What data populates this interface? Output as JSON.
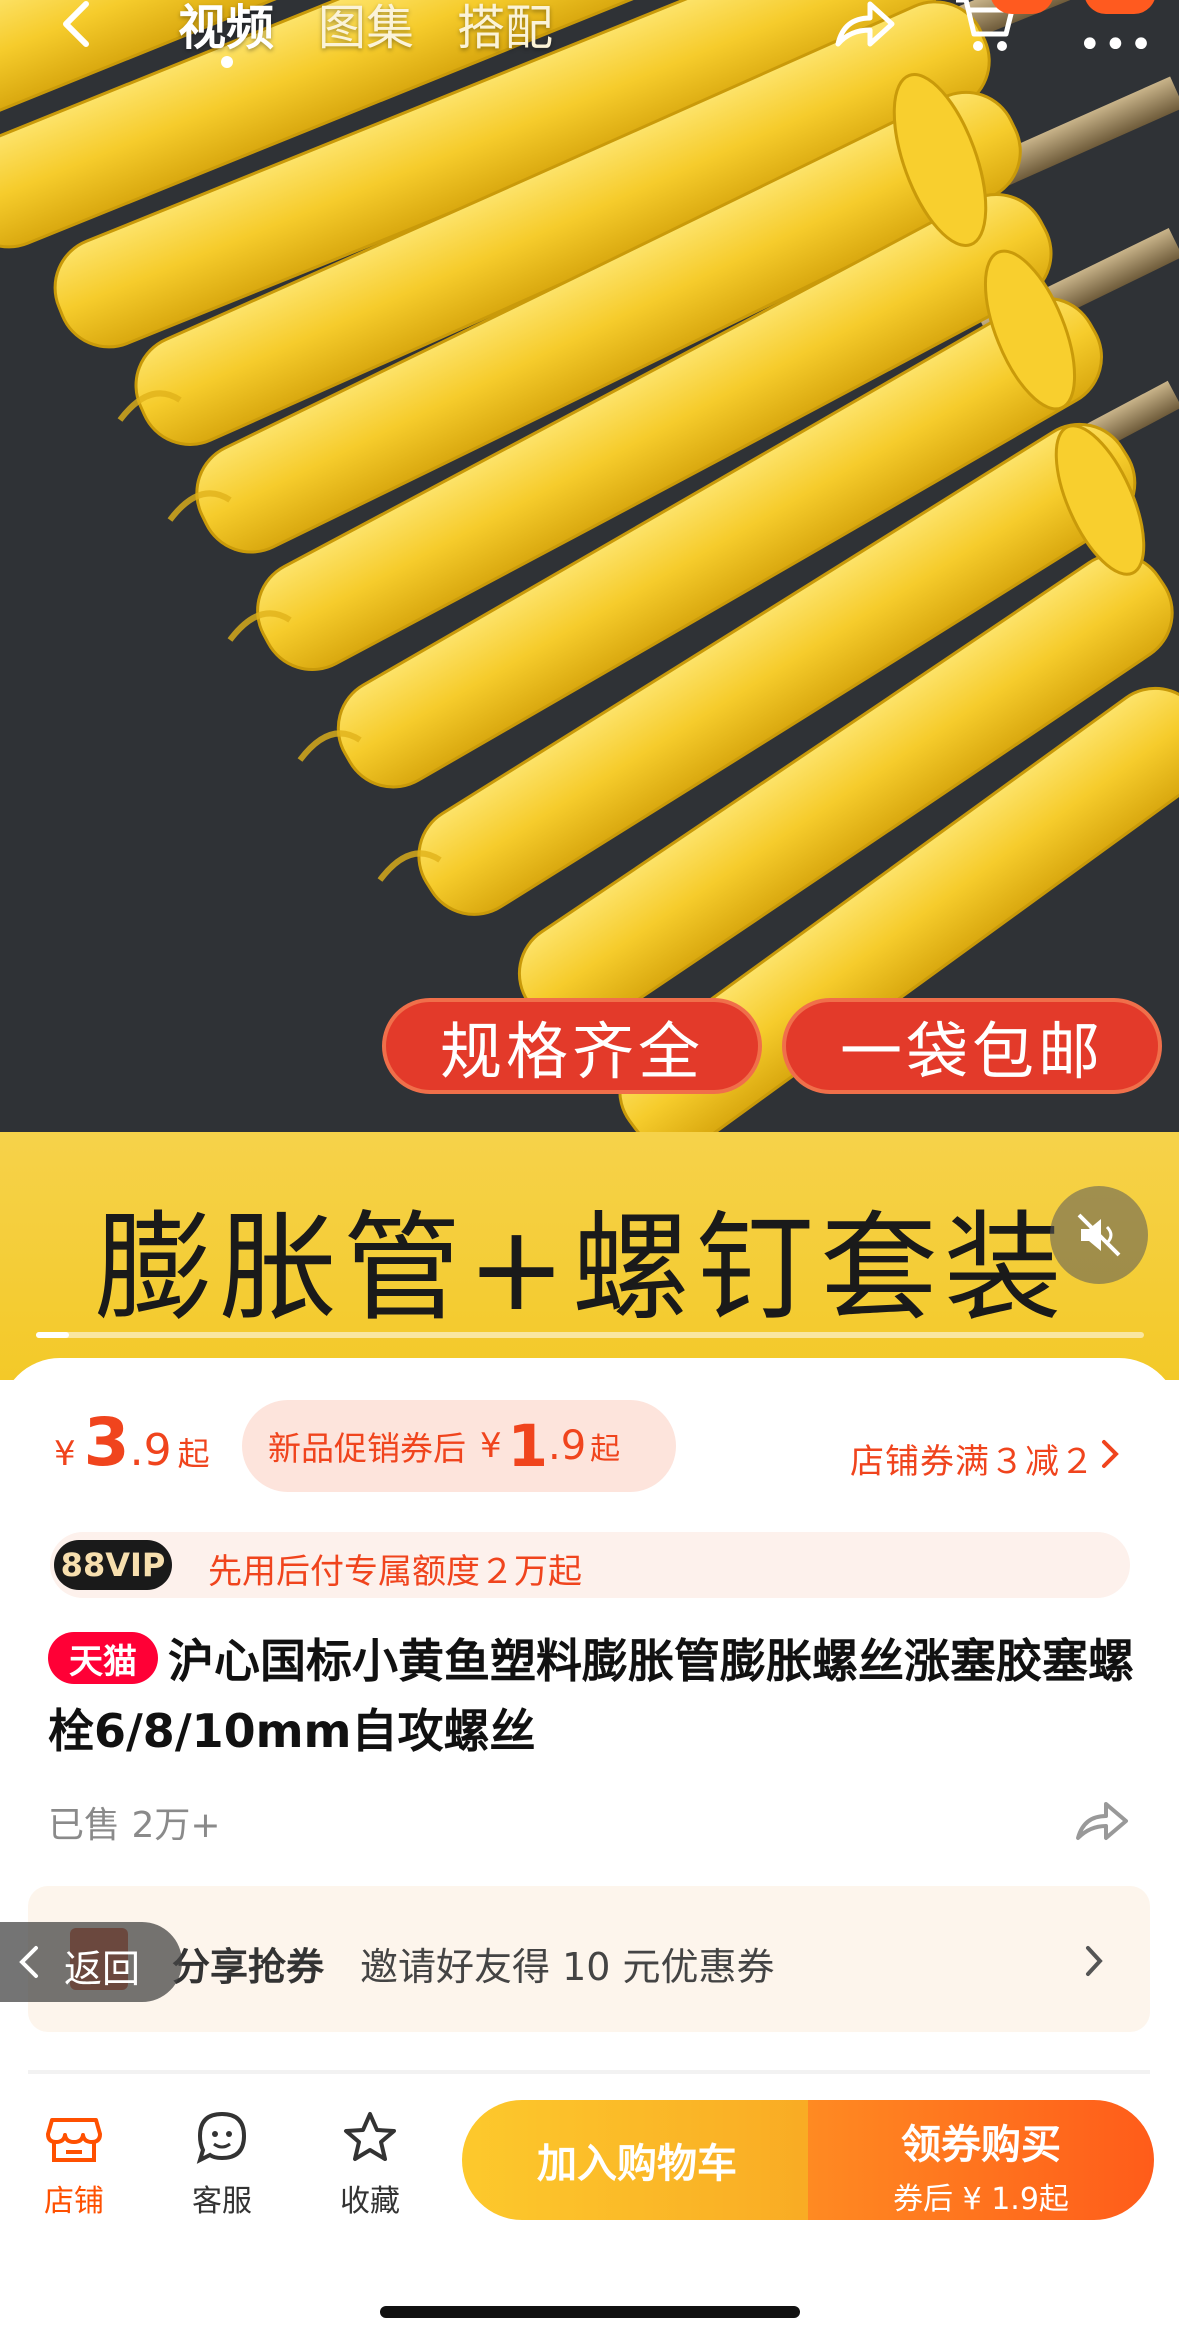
{
  "nav": {
    "tabs": [
      "视频",
      "图集",
      "搭配"
    ]
  },
  "media": {
    "pill_1": "规格齐全",
    "pill_2": "一袋包邮",
    "banner": "膨胀管+螺钉套装",
    "progress": 0.03
  },
  "price": {
    "symbol": "¥",
    "integer": "3",
    "decimal": ".9",
    "suffix": "起"
  },
  "promo": {
    "label": "新品促销券后",
    "symbol": "¥",
    "integer": "1",
    "decimal": ".9",
    "suffix": "起"
  },
  "store_coupon": "店铺券满３减２",
  "vip": {
    "badge": "88VIP",
    "text": "先用后付专属额度２万起"
  },
  "product": {
    "tag": "天猫",
    "title": "沪心国标小黄鱼塑料膨胀管膨胀螺丝涨塞胶塞螺栓6/8/10mm自攻螺丝",
    "sold": "已售 2万+"
  },
  "share_coupon": {
    "title": "分享抢券",
    "desc": "邀请好友得 10 元优惠券"
  },
  "float_back": "返回",
  "bottom": {
    "store": "店铺",
    "service": "客服",
    "favorite": "收藏",
    "add_cart": "加入购物车",
    "buy_main": "领券购买",
    "buy_sub": "券后 ¥ 1.9起"
  },
  "colors": {
    "accent": "#f0441d",
    "tmall": "#ff0036",
    "cart_btn": "#fdc92c",
    "buy_btn": "#ff5c1a"
  }
}
